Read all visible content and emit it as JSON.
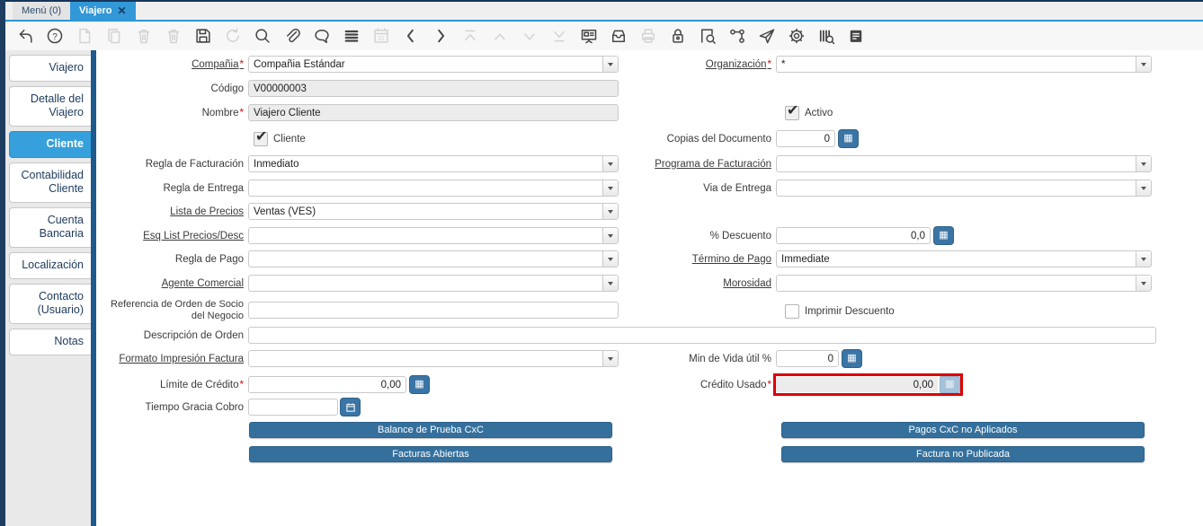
{
  "window": {
    "tabs": [
      {
        "label": "Menú (0)",
        "active": false
      },
      {
        "label": "Viajero",
        "active": true,
        "closable": true
      }
    ]
  },
  "toolbar": {
    "icons": [
      {
        "name": "undo-icon",
        "enabled": true
      },
      {
        "name": "help-icon",
        "enabled": true
      },
      {
        "name": "new-record-icon",
        "enabled": false
      },
      {
        "name": "copy-record-icon",
        "enabled": false
      },
      {
        "name": "delete-record-icon",
        "enabled": false
      },
      {
        "name": "delete-selection-icon",
        "enabled": false
      },
      {
        "name": "save-icon",
        "enabled": true
      },
      {
        "name": "refresh-icon",
        "enabled": false
      },
      {
        "name": "find-icon",
        "enabled": true
      },
      {
        "name": "attachment-icon",
        "enabled": true
      },
      {
        "name": "chat-icon",
        "enabled": true
      },
      {
        "name": "grid-toggle-icon",
        "enabled": true
      },
      {
        "name": "calendar-icon",
        "enabled": false
      },
      {
        "name": "parent-record-icon",
        "enabled": true
      },
      {
        "name": "detail-record-icon",
        "enabled": true
      },
      {
        "name": "first-record-icon",
        "enabled": false
      },
      {
        "name": "previous-record-icon",
        "enabled": false
      },
      {
        "name": "next-record-icon",
        "enabled": false
      },
      {
        "name": "last-record-icon",
        "enabled": false
      },
      {
        "name": "report-icon",
        "enabled": true
      },
      {
        "name": "archive-icon",
        "enabled": true
      },
      {
        "name": "print-icon",
        "enabled": false
      },
      {
        "name": "lock-icon",
        "enabled": true
      },
      {
        "name": "zoom-across-icon",
        "enabled": true
      },
      {
        "name": "workflow-icon",
        "enabled": true
      },
      {
        "name": "request-icon",
        "enabled": true
      },
      {
        "name": "preferences-icon",
        "enabled": true
      },
      {
        "name": "product-info-icon",
        "enabled": true
      },
      {
        "name": "report-document-icon",
        "enabled": true
      }
    ]
  },
  "sidebar": {
    "tabs": [
      {
        "label": "Viajero",
        "active": false
      },
      {
        "label": "Detalle del Viajero",
        "active": false
      },
      {
        "label": "Cliente",
        "active": true
      },
      {
        "label": "Contabilidad Cliente",
        "active": false
      },
      {
        "label": "Cuenta Bancaria",
        "active": false
      },
      {
        "label": "Localización",
        "active": false
      },
      {
        "label": "Contacto (Usuario)",
        "active": false
      },
      {
        "label": "Notas",
        "active": false
      }
    ]
  },
  "form": {
    "fields": {
      "compania": {
        "label": "Compañia",
        "value": "Compañia Estándar",
        "required": true
      },
      "organizacion": {
        "label": "Organización",
        "value": "*",
        "required": true
      },
      "codigo": {
        "label": "Código",
        "value": "V00000003"
      },
      "nombre": {
        "label": "Nombre",
        "value": "Viajero Cliente",
        "required": true
      },
      "activo": {
        "label": "Activo",
        "checked": true
      },
      "cliente": {
        "label": "Cliente",
        "checked": true
      },
      "copias_documento": {
        "label": "Copias del Documento",
        "value": "0"
      },
      "regla_facturacion": {
        "label": "Regla de Facturación",
        "value": "Inmediato"
      },
      "programa_facturacion": {
        "label": "Programa de Facturación",
        "value": ""
      },
      "regla_entrega": {
        "label": "Regla de Entrega",
        "value": ""
      },
      "via_entrega": {
        "label": "Via de Entrega",
        "value": ""
      },
      "lista_precios": {
        "label": "Lista de Precios",
        "value": "Ventas (VES)"
      },
      "esq_list_precios": {
        "label": "Esq List Precios/Desc",
        "value": ""
      },
      "descuento": {
        "label": "% Descuento",
        "value": "0,0"
      },
      "regla_pago": {
        "label": "Regla de Pago",
        "value": ""
      },
      "termino_pago": {
        "label": "Término de Pago",
        "value": "Immediate"
      },
      "agente_comercial": {
        "label": "Agente Comercial",
        "value": ""
      },
      "morosidad": {
        "label": "Morosidad",
        "value": ""
      },
      "referencia_orden": {
        "label": "Referencia de Orden de Socio del Negocio",
        "value": ""
      },
      "imprimir_descuento": {
        "label": "Imprimir Descuento",
        "checked": false
      },
      "descripcion_orden": {
        "label": "Descripción de Orden",
        "value": ""
      },
      "formato_impresion": {
        "label": "Formato Impresión Factura",
        "value": ""
      },
      "min_vida_util": {
        "label": "Min de Vida útil %",
        "value": "0"
      },
      "limite_credito": {
        "label": "Límite de Crédito",
        "value": "0,00",
        "required": true
      },
      "credito_usado": {
        "label": "Crédito Usado",
        "value": "0,00",
        "required": true,
        "highlighted": true
      },
      "tiempo_gracia": {
        "label": "Tiempo Gracia Cobro",
        "value": ""
      }
    },
    "buttons": {
      "balance": "Balance de Prueba CxC",
      "facturas_abiertas": "Facturas Abiertas",
      "pagos": "Pagos CxC no Aplicados",
      "factura_no_publicada": "Factura no Publicada"
    }
  },
  "colors": {
    "accent_blue": "#3298d8",
    "active_tab_blue": "#35a0dc",
    "button_blue": "#35709d",
    "calc_button_blue": "#3a75a5",
    "highlight_red": "#dd0000",
    "navy_edge": "#1e3d60",
    "sidebar_bar": "#1d5a8d"
  }
}
